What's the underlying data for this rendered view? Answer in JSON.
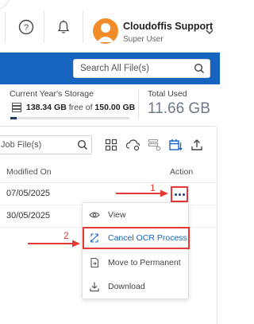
{
  "header": {
    "help_icon": "help-circle-icon",
    "bell_icon": "bell-icon",
    "user": {
      "name": "Cloudoffis Support",
      "role": "Super User"
    }
  },
  "search_all": {
    "placeholder": "Search All File(s)"
  },
  "storage": {
    "title": "Current Year's Storage",
    "used": "138.34 GB",
    "free_text": "free of",
    "capacity": "150.00 GB",
    "usage_fraction": 0.05
  },
  "total": {
    "title": "Total Used",
    "value": "11.66 GB"
  },
  "toolbar": {
    "job_search_placeholder": "Job File(s)"
  },
  "table": {
    "headers": {
      "modified_on": "Modified On",
      "action": "Action"
    },
    "rows": [
      {
        "modified_on": "07/05/2025"
      },
      {
        "modified_on": "30/05/2025"
      }
    ]
  },
  "annotations": {
    "step1": "1",
    "step2": "2",
    "color": "#e53935"
  },
  "menu": {
    "items": [
      {
        "label": "View",
        "icon": "eye-icon"
      },
      {
        "label": "Cancel OCR Process",
        "icon": "cancel-ocr-icon"
      },
      {
        "label": "Move to Permanent",
        "icon": "move-permanent-icon"
      },
      {
        "label": "Download",
        "icon": "download-icon"
      }
    ]
  },
  "colors": {
    "brand_blue": "#1565c0",
    "avatar": "#f28c28",
    "highlight": "#e53935"
  }
}
